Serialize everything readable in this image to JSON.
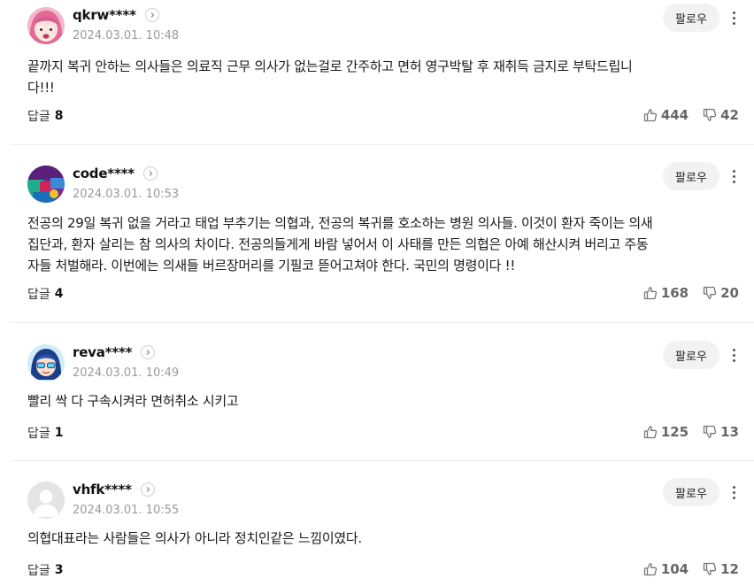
{
  "follow_label": "팔로우",
  "reply_label": "답글",
  "comments": [
    {
      "username": "qkrw****",
      "date": "2024.03.01. 10:48",
      "text": "끝까지 복귀 안하는 의사들은 의료직 근무 의사가 없는걸로 간주하고 면허 영구박탈 후 재취득 금지로 부탁드립니\n다!!!",
      "replies": "8",
      "likes": "444",
      "dislikes": "42",
      "avatar": "anime-girl-pink"
    },
    {
      "username": "code****",
      "date": "2024.03.01. 10:53",
      "text": "전공의 29일 복귀 없을 거라고 태업 부추기는 의협과, 전공의 복귀를 호소하는 병원 의사들. 이것이 환자 죽이는 의새\n집단과, 환자 살리는 참 의사의 차이다. 전공의들게게 바람 넣어서 이 사태를 만든 의협은 아예 해산시켜 버리고 주동\n자들 처벌해라. 이번에는 의새들 버르장머리를 기필코 뜯어고쳐야 한다. 국민의 명령이다 !!",
      "replies": "4",
      "likes": "168",
      "dislikes": "20",
      "avatar": "colorful-abstract"
    },
    {
      "username": "reva****",
      "date": "2024.03.01. 10:49",
      "text": "빨리 싹 다 구속시켜라 면허취소 시키고",
      "replies": "1",
      "likes": "125",
      "dislikes": "13",
      "avatar": "cartoon-blue-hair"
    },
    {
      "username": "vhfk****",
      "date": "2024.03.01. 10:55",
      "text": "의협대표라는 사람들은 의사가 아니라 정치인같은 느낌이였다.",
      "replies": "3",
      "likes": "104",
      "dislikes": "12",
      "avatar": "default-person"
    }
  ]
}
